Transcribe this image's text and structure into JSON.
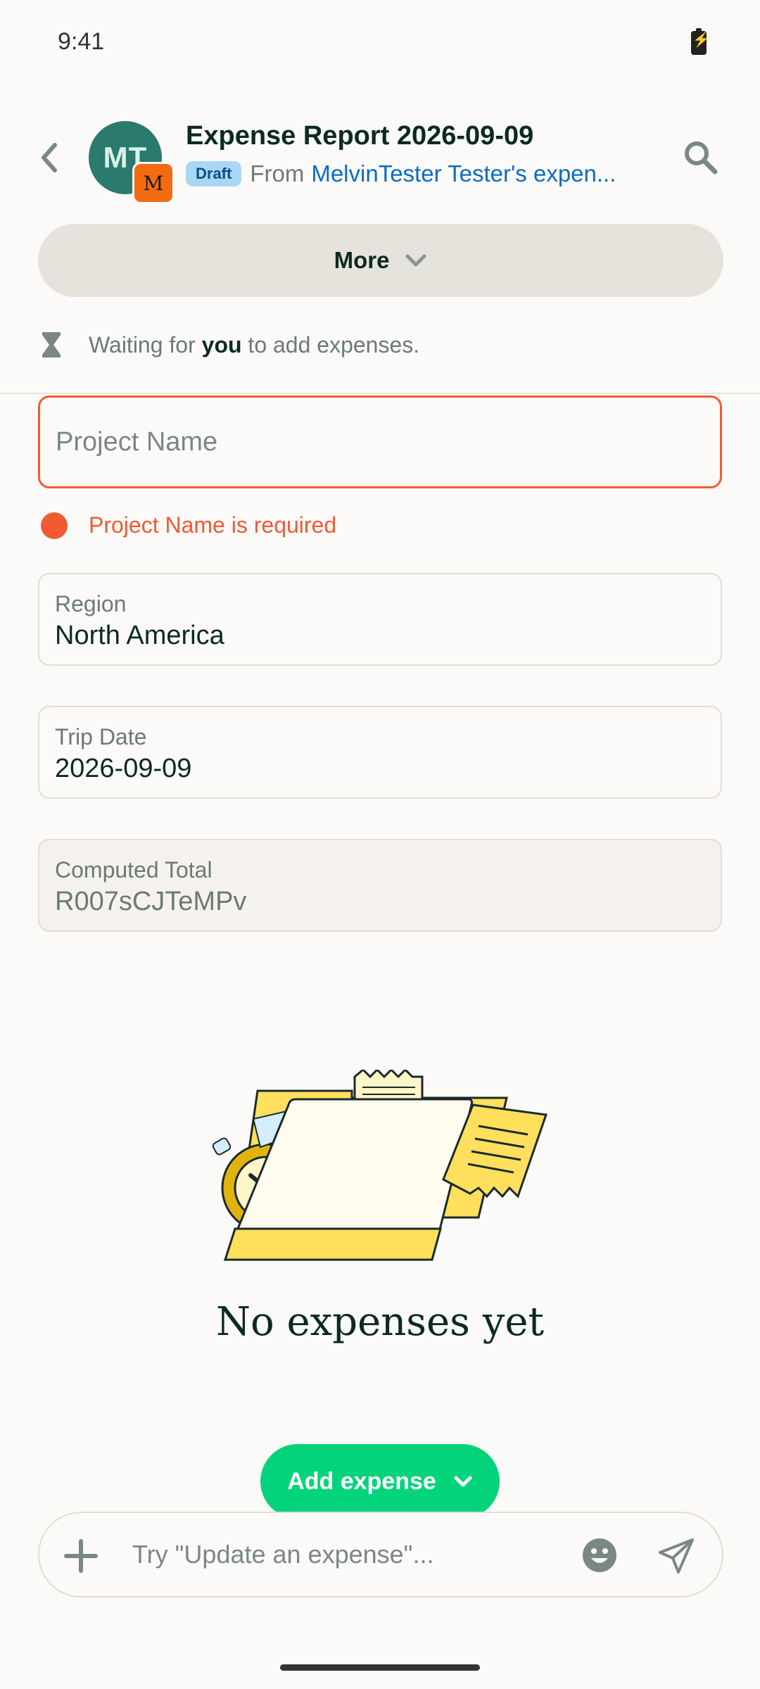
{
  "status_bar": {
    "time": "9:41"
  },
  "header": {
    "avatar_initials": "MT",
    "avatar_badge_letter": "M",
    "title": "Expense Report 2026-09-09",
    "badge": "Draft",
    "from_prefix": "From",
    "from_link": "MelvinTester Tester's expen..."
  },
  "more_button": {
    "label": "More"
  },
  "waiting": {
    "prefix": "Waiting for",
    "emphasis": "you",
    "suffix": "to add expenses."
  },
  "fields": {
    "project_name": {
      "placeholder": "Project Name",
      "error": "Project Name is required"
    },
    "region": {
      "label": "Region",
      "value": "North America"
    },
    "trip_date": {
      "label": "Trip Date",
      "value": "2026-09-09"
    },
    "computed_total": {
      "label": "Computed Total",
      "value": "R007sCJTeMPv"
    }
  },
  "empty_state": {
    "title": "No expenses yet"
  },
  "add_expense": {
    "label": "Add expense"
  },
  "composer": {
    "placeholder": "Try \"Update an expense\"..."
  },
  "colors": {
    "accent_green": "#03D47C",
    "error": "#F25A32",
    "link": "#0B6BC2",
    "draft_badge_bg": "#A9D6F5",
    "avatar_bg": "#2A7A6E"
  },
  "icons": [
    "back-arrow-icon",
    "search-icon",
    "chevron-down-icon",
    "hourglass-icon",
    "error-dot-icon",
    "plus-icon",
    "emoji-icon",
    "send-icon"
  ]
}
